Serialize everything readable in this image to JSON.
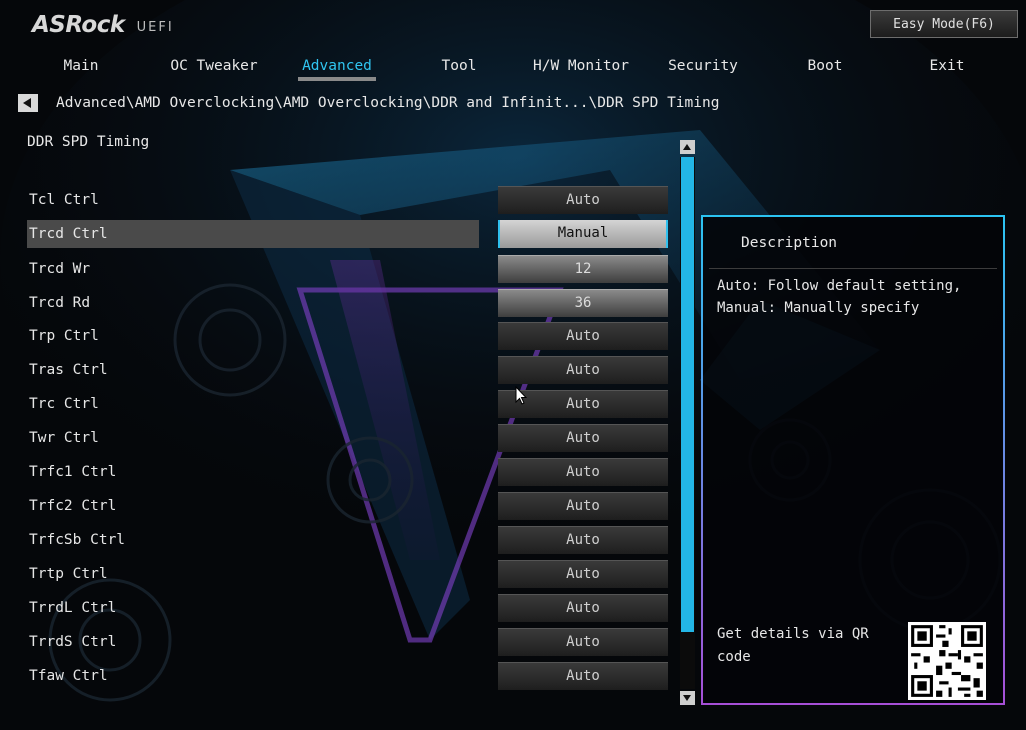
{
  "header": {
    "logo_brand": "ASRock",
    "logo_sub": "UEFI",
    "easy_mode_label": "Easy Mode(F6)"
  },
  "tabs": [
    {
      "label": "Main",
      "active": false
    },
    {
      "label": "OC Tweaker",
      "active": false
    },
    {
      "label": "Advanced",
      "active": true
    },
    {
      "label": "Tool",
      "active": false
    },
    {
      "label": "H/W Monitor",
      "active": false
    },
    {
      "label": "Security",
      "active": false
    },
    {
      "label": "Boot",
      "active": false
    },
    {
      "label": "Exit",
      "active": false
    }
  ],
  "breadcrumb": "Advanced\\AMD Overclocking\\AMD Overclocking\\DDR and Infinit...\\DDR SPD Timing",
  "section_title": "DDR SPD Timing",
  "settings": [
    {
      "label": "Tcl Ctrl",
      "value": "Auto"
    },
    {
      "label": "Trcd Ctrl",
      "value": "Manual",
      "selected": true
    },
    {
      "label": "Trcd Wr",
      "value": "12"
    },
    {
      "label": "Trcd Rd",
      "value": "36"
    },
    {
      "label": "Trp Ctrl",
      "value": "Auto"
    },
    {
      "label": "Tras Ctrl",
      "value": "Auto"
    },
    {
      "label": "Trc Ctrl",
      "value": "Auto"
    },
    {
      "label": "Twr Ctrl",
      "value": "Auto"
    },
    {
      "label": "Trfc1 Ctrl",
      "value": "Auto"
    },
    {
      "label": "Trfc2 Ctrl",
      "value": "Auto"
    },
    {
      "label": "TrfcSb Ctrl",
      "value": "Auto"
    },
    {
      "label": "Trtp Ctrl",
      "value": "Auto"
    },
    {
      "label": "TrrdL Ctrl",
      "value": "Auto"
    },
    {
      "label": "TrrdS Ctrl",
      "value": "Auto"
    },
    {
      "label": "Tfaw Ctrl",
      "value": "Auto"
    }
  ],
  "description": {
    "title": "Description",
    "text": "Auto: Follow default setting,\nManual: Manually specify",
    "qr_text": "Get details via QR code"
  },
  "colors": {
    "accent": "#2fc0ee",
    "panel_border_top": "#2bc4f2",
    "panel_border_bottom": "#a64fd6"
  }
}
